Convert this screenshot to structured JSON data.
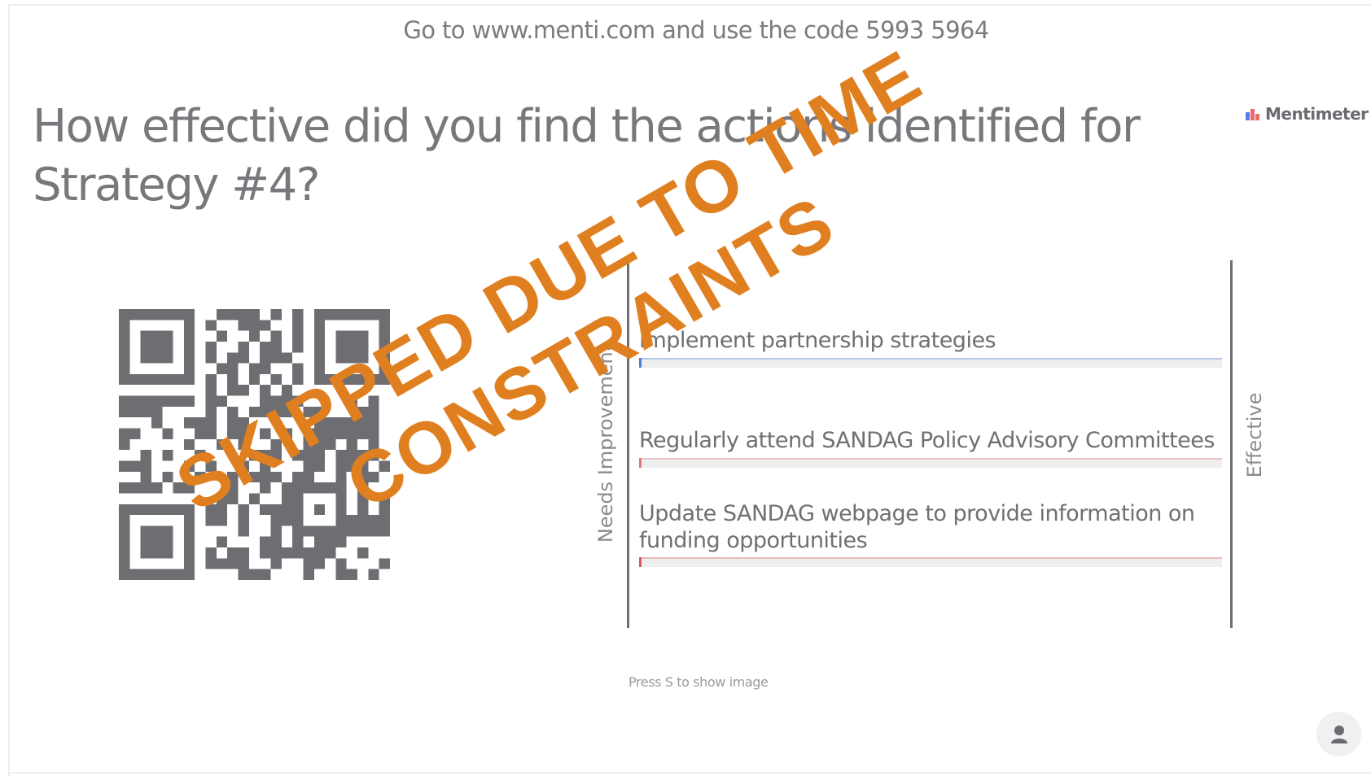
{
  "header": {
    "join_text": "Go to www.menti.com and use the code 5993 5964"
  },
  "brand": {
    "name": "Mentimeter",
    "icon": "mentimeter-logo-icon"
  },
  "question": {
    "title": "How effective did you find the actions identified for Strategy #4?"
  },
  "qr_code": {
    "icon": "qr-code-icon"
  },
  "scale": {
    "left_label": "Needs Improvement",
    "right_label": "Effective"
  },
  "statements": [
    {
      "label": "Implement partnership strategies",
      "color": "#4a7fd6"
    },
    {
      "label": "Regularly attend SANDAG Policy Advisory Committees",
      "color": "#e07a7a"
    },
    {
      "label": "Update SANDAG webpage to provide information on funding opportunities",
      "color": "#e05a5a"
    }
  ],
  "hint": "Press S to show image",
  "overlay": {
    "line1": "SKIPPED DUE TO TIME",
    "line2": "CONSTRAINTS",
    "color": "#e07f1f"
  },
  "avatar": {
    "icon": "person-icon"
  }
}
